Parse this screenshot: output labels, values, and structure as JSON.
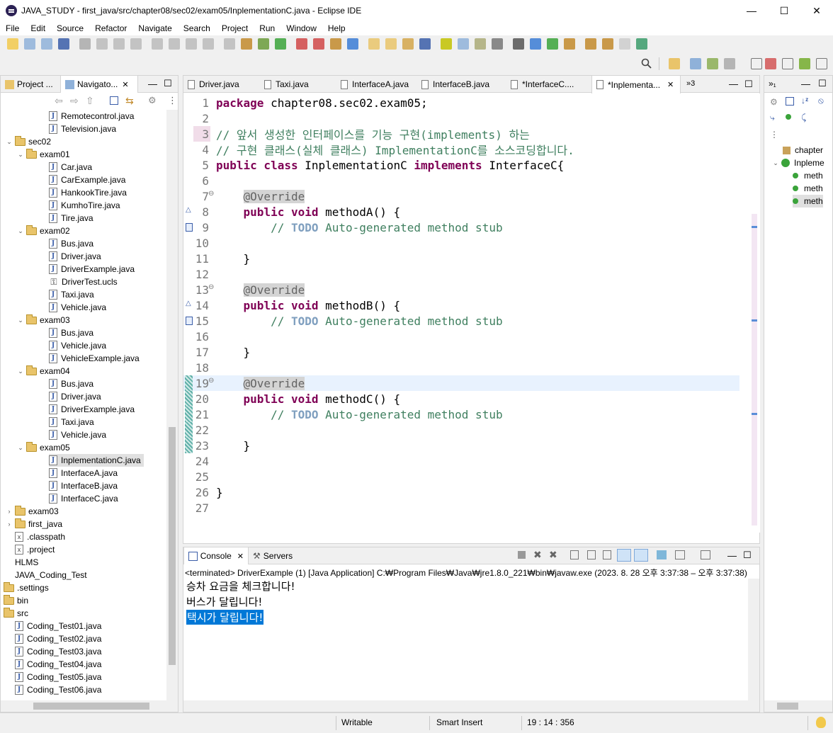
{
  "window": {
    "title": "JAVA_STUDY - first_java/src/chapter08/sec02/exam05/InplementationC.java - Eclipse IDE",
    "minimize": "—",
    "maximize": "☐",
    "close": "✕"
  },
  "menu": [
    "File",
    "Edit",
    "Source",
    "Refactor",
    "Navigate",
    "Search",
    "Project",
    "Run",
    "Window",
    "Help"
  ],
  "left_panel": {
    "tabs": [
      "Project ...",
      "Navigato..."
    ],
    "tree": [
      {
        "label": "Remotecontrol.java",
        "type": "java",
        "indent": 3
      },
      {
        "label": "Television.java",
        "type": "java",
        "indent": 3
      },
      {
        "label": "sec02",
        "type": "folder",
        "indent": 1,
        "expanded": true
      },
      {
        "label": "exam01",
        "type": "folder",
        "indent": 2,
        "expanded": true
      },
      {
        "label": "Car.java",
        "type": "java",
        "indent": 3
      },
      {
        "label": "CarExample.java",
        "type": "java",
        "indent": 3
      },
      {
        "label": "HankookTire.java",
        "type": "java",
        "indent": 3
      },
      {
        "label": "KumhoTire.java",
        "type": "java",
        "indent": 3
      },
      {
        "label": "Tire.java",
        "type": "java",
        "indent": 3
      },
      {
        "label": "exam02",
        "type": "folder",
        "indent": 2,
        "expanded": true
      },
      {
        "label": "Bus.java",
        "type": "java",
        "indent": 3
      },
      {
        "label": "Driver.java",
        "type": "java",
        "indent": 3
      },
      {
        "label": "DriverExample.java",
        "type": "java",
        "indent": 3
      },
      {
        "label": "DriverTest.ucls",
        "type": "ucls",
        "indent": 3
      },
      {
        "label": "Taxi.java",
        "type": "java",
        "indent": 3
      },
      {
        "label": "Vehicle.java",
        "type": "java",
        "indent": 3
      },
      {
        "label": "exam03",
        "type": "folder",
        "indent": 2,
        "expanded": true
      },
      {
        "label": "Bus.java",
        "type": "java",
        "indent": 3
      },
      {
        "label": "Vehicle.java",
        "type": "java",
        "indent": 3
      },
      {
        "label": "VehicleExample.java",
        "type": "java",
        "indent": 3
      },
      {
        "label": "exam04",
        "type": "folder",
        "indent": 2,
        "expanded": true
      },
      {
        "label": "Bus.java",
        "type": "java",
        "indent": 3
      },
      {
        "label": "Driver.java",
        "type": "java",
        "indent": 3
      },
      {
        "label": "DriverExample.java",
        "type": "java",
        "indent": 3
      },
      {
        "label": "Taxi.java",
        "type": "java",
        "indent": 3
      },
      {
        "label": "Vehicle.java",
        "type": "java",
        "indent": 3
      },
      {
        "label": "exam05",
        "type": "folder",
        "indent": 2,
        "expanded": true
      },
      {
        "label": "InplementationC.java",
        "type": "java",
        "indent": 3,
        "selected": true
      },
      {
        "label": "InterfaceA.java",
        "type": "java",
        "indent": 3
      },
      {
        "label": "InterfaceB.java",
        "type": "java",
        "indent": 3
      },
      {
        "label": "InterfaceC.java",
        "type": "java",
        "indent": 3
      },
      {
        "label": "exam03",
        "type": "folder",
        "indent": 0,
        "expanded": false
      },
      {
        "label": "first_java",
        "type": "folder",
        "indent": 0
      },
      {
        "label": ".classpath",
        "type": "x",
        "indent": 0
      },
      {
        "label": ".project",
        "type": "x",
        "indent": 0
      },
      {
        "label": "HLMS",
        "type": "plain",
        "indent": 0
      },
      {
        "label": "JAVA_Coding_Test",
        "type": "plain",
        "indent": 0
      },
      {
        "label": ".settings",
        "type": "folder",
        "indent": -1
      },
      {
        "label": "bin",
        "type": "folder",
        "indent": -1
      },
      {
        "label": "src",
        "type": "folder",
        "indent": -1
      },
      {
        "label": "Coding_Test01.java",
        "type": "java",
        "indent": 0
      },
      {
        "label": "Coding_Test02.java",
        "type": "java",
        "indent": 0
      },
      {
        "label": "Coding_Test03.java",
        "type": "java",
        "indent": 0
      },
      {
        "label": "Coding_Test04.java",
        "type": "java",
        "indent": 0
      },
      {
        "label": "Coding_Test05.java",
        "type": "java",
        "indent": 0
      },
      {
        "label": "Coding_Test06.java",
        "type": "java",
        "indent": 0
      }
    ]
  },
  "editor": {
    "tabs": [
      "Driver.java",
      "Taxi.java",
      "InterfaceA.java",
      "InterfaceB.java",
      "*InterfaceC....",
      "*Inplementa..."
    ],
    "overflow": "»3",
    "current_line": 19,
    "lines": [
      {
        "n": "1",
        "parts": [
          {
            "k": "kw",
            "t": "package"
          },
          {
            "k": "",
            "t": " chapter08.sec02.exam05;"
          }
        ]
      },
      {
        "n": "2",
        "parts": []
      },
      {
        "n": "3",
        "parts": [
          {
            "k": "cm",
            "t": "// 앞서 생성한 인터페이스를 기능 구현(implements) 하는"
          }
        ]
      },
      {
        "n": "4",
        "parts": [
          {
            "k": "cm",
            "t": "// 구현 클래스(실체 클래스) ImplementationC를 소스코딩합니다."
          }
        ]
      },
      {
        "n": "5",
        "parts": [
          {
            "k": "kw",
            "t": "public class"
          },
          {
            "k": "",
            "t": " InplementationC "
          },
          {
            "k": "kw",
            "t": "implements"
          },
          {
            "k": "",
            "t": " InterfaceC{"
          }
        ]
      },
      {
        "n": "6",
        "parts": []
      },
      {
        "n": "7",
        "parts": [
          {
            "k": "",
            "t": "    "
          },
          {
            "k": "an",
            "t": "@Override"
          }
        ]
      },
      {
        "n": "8",
        "parts": [
          {
            "k": "",
            "t": "    "
          },
          {
            "k": "kw",
            "t": "public void"
          },
          {
            "k": "",
            "t": " methodA() {"
          }
        ]
      },
      {
        "n": "9",
        "parts": [
          {
            "k": "cm",
            "t": "        // "
          },
          {
            "k": "todo",
            "t": "TODO"
          },
          {
            "k": "cm",
            "t": " Auto-generated method stub"
          }
        ]
      },
      {
        "n": "10",
        "parts": []
      },
      {
        "n": "11",
        "parts": [
          {
            "k": "",
            "t": "    }"
          }
        ]
      },
      {
        "n": "12",
        "parts": []
      },
      {
        "n": "13",
        "parts": [
          {
            "k": "",
            "t": "    "
          },
          {
            "k": "an",
            "t": "@Override"
          }
        ]
      },
      {
        "n": "14",
        "parts": [
          {
            "k": "",
            "t": "    "
          },
          {
            "k": "kw",
            "t": "public void"
          },
          {
            "k": "",
            "t": " methodB() {"
          }
        ]
      },
      {
        "n": "15",
        "parts": [
          {
            "k": "cm",
            "t": "        // "
          },
          {
            "k": "todo",
            "t": "TODO"
          },
          {
            "k": "cm",
            "t": " Auto-generated method stub"
          }
        ]
      },
      {
        "n": "16",
        "parts": []
      },
      {
        "n": "17",
        "parts": [
          {
            "k": "",
            "t": "    }"
          }
        ]
      },
      {
        "n": "18",
        "parts": []
      },
      {
        "n": "19",
        "parts": [
          {
            "k": "",
            "t": "    "
          },
          {
            "k": "an",
            "t": "@Override"
          }
        ]
      },
      {
        "n": "20",
        "parts": [
          {
            "k": "",
            "t": "    "
          },
          {
            "k": "kw",
            "t": "public void"
          },
          {
            "k": "",
            "t": " methodC() {"
          }
        ]
      },
      {
        "n": "21",
        "parts": [
          {
            "k": "cm",
            "t": "        // "
          },
          {
            "k": "todo",
            "t": "TODO"
          },
          {
            "k": "cm",
            "t": " Auto-generated method stub"
          }
        ]
      },
      {
        "n": "22",
        "parts": []
      },
      {
        "n": "23",
        "parts": [
          {
            "k": "",
            "t": "    }"
          }
        ]
      },
      {
        "n": "24",
        "parts": []
      },
      {
        "n": "25",
        "parts": []
      },
      {
        "n": "26",
        "parts": [
          {
            "k": "",
            "t": "}"
          }
        ]
      },
      {
        "n": "27",
        "parts": []
      }
    ]
  },
  "outline": {
    "items": [
      {
        "label": "chapter",
        "icon": "package-icon"
      },
      {
        "label": "Inpleme",
        "icon": "class-icon"
      },
      {
        "label": "meth",
        "icon": "method-icon"
      },
      {
        "label": "meth",
        "icon": "method-icon"
      },
      {
        "label": "meth",
        "icon": "method-icon",
        "selected": true
      }
    ]
  },
  "console": {
    "tabs": [
      "Console",
      "Servers"
    ],
    "header": "<terminated> DriverExample (1) [Java Application] C:₩Program Files₩Java₩jre1.8.0_221₩bin₩javaw.exe  (2023. 8. 28 오후 3:37:38 – 오후 3:37:38)",
    "output": [
      "승차 요금을 체크합니다!",
      "버스가 달립니다!",
      "택시가 달립니다!"
    ],
    "selected_line": 2
  },
  "status": {
    "writable": "Writable",
    "insert_mode": "Smart Insert",
    "position": "19 : 14 : 356"
  },
  "colors": {
    "keyword": "#7f0055",
    "comment": "#3f7f5f",
    "todo": "#7f9fbf",
    "annotation": "#646464",
    "selection": "#0078d7"
  }
}
